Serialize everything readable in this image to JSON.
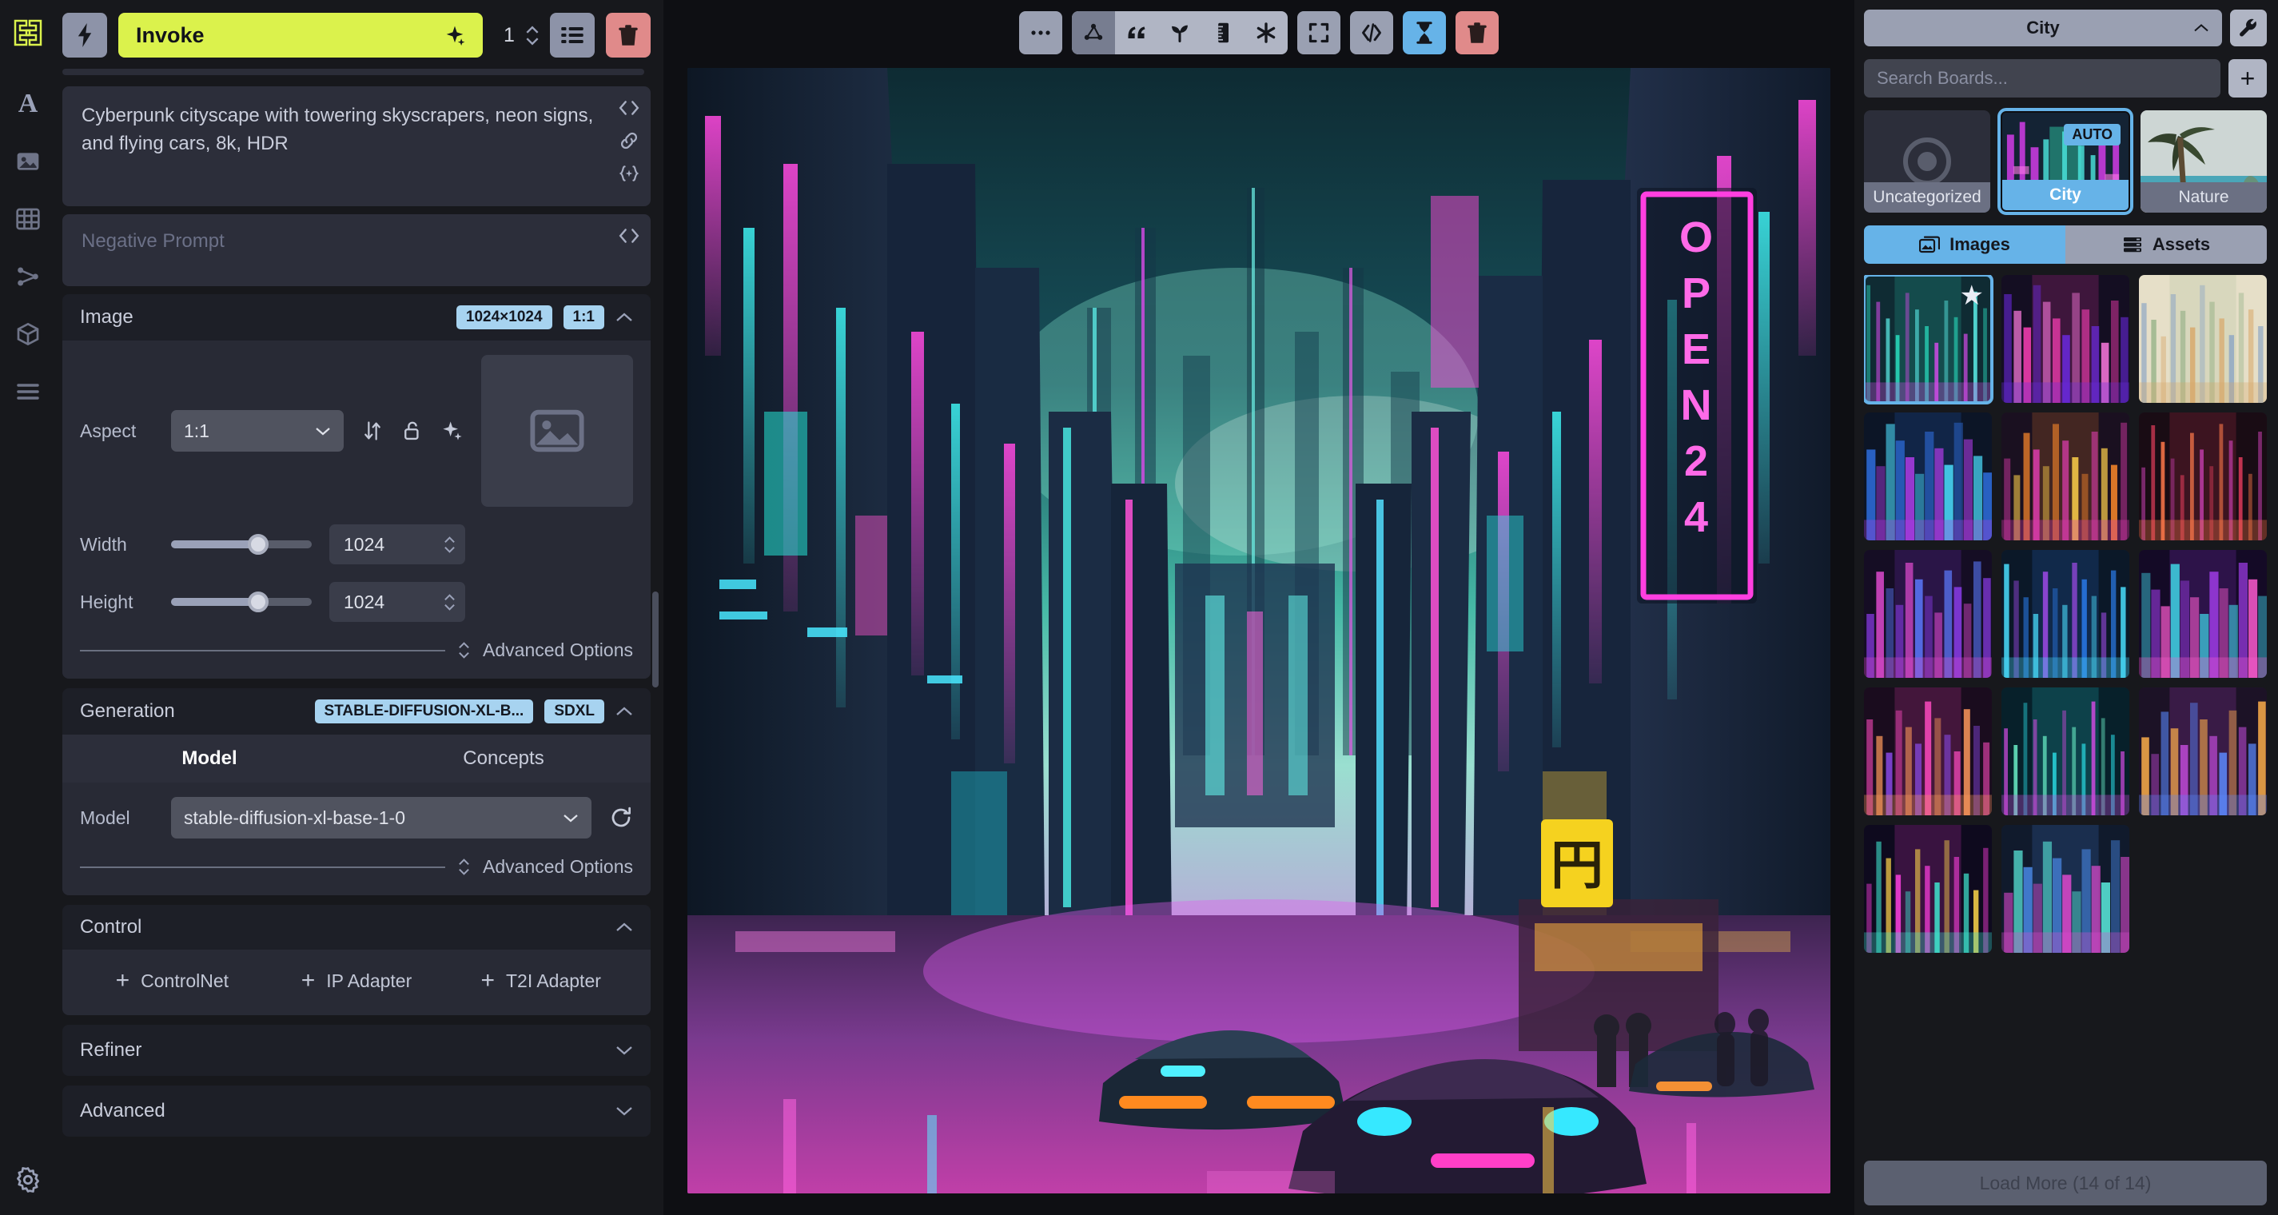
{
  "rail": {
    "logo_name": "invoke-logo",
    "items": [
      {
        "name": "text-to-image",
        "icon": "letter-A-icon",
        "label": "A"
      },
      {
        "name": "image-viewer",
        "icon": "image-icon",
        "label": ""
      },
      {
        "name": "grid-gallery",
        "icon": "grid-icon",
        "label": ""
      },
      {
        "name": "nodes-workflow",
        "icon": "nodes-icon",
        "label": ""
      },
      {
        "name": "models",
        "icon": "cube-icon",
        "label": ""
      },
      {
        "name": "queue-list",
        "icon": "list-icon",
        "label": ""
      }
    ],
    "settings_label": "gear-icon"
  },
  "topbar": {
    "bolt_icon": "lightning-bolt-icon",
    "invoke_label": "Invoke",
    "sparkle_icon": "sparkle-icon",
    "iterations": "1",
    "queue_icon": "queue-list-icon",
    "trash_icon": "trash-icon"
  },
  "prompt": {
    "positive": "Cyberpunk cityscape with towering skyscrapers, neon signs, and flying cars, 8k, HDR",
    "negative_placeholder": "Negative Prompt",
    "code_icon": "code-brackets-icon",
    "link_icon": "link-icon",
    "sparkle_icon": "sparkle-braces-icon"
  },
  "image_section": {
    "title": "Image",
    "size_badge": "1024×1024",
    "ratio_badge": "1:1",
    "aspect_label": "Aspect",
    "aspect_value": "1:1",
    "swap_icon": "swap-dimensions-icon",
    "lock_icon": "unlock-icon",
    "auto_icon": "sparkle-icon",
    "width_label": "Width",
    "width_value": "1024",
    "width_pct": 62,
    "height_label": "Height",
    "height_value": "1024",
    "height_pct": 62,
    "advanced_label": "Advanced Options",
    "thumb_icon": "image-placeholder-icon"
  },
  "generation_section": {
    "title": "Generation",
    "model_badge": "STABLE-DIFFUSION-XL-B...",
    "arch_badge": "SDXL",
    "tabs": [
      {
        "label": "Model",
        "active": true
      },
      {
        "label": "Concepts",
        "active": false
      }
    ],
    "model_label": "Model",
    "model_value": "stable-diffusion-xl-base-1-0",
    "refresh_icon": "refresh-icon",
    "advanced_label": "Advanced Options"
  },
  "control_section": {
    "title": "Control",
    "buttons": [
      {
        "label": "ControlNet",
        "name": "add-controlnet-button"
      },
      {
        "label": "IP Adapter",
        "name": "add-ip-adapter-button"
      },
      {
        "label": "T2I Adapter",
        "name": "add-t2i-adapter-button"
      }
    ]
  },
  "refiner_section": {
    "title": "Refiner"
  },
  "advanced_section": {
    "title": "Advanced"
  },
  "canvas": {
    "toolbar": [
      {
        "name": "more-options-button",
        "icon": "ellipsis-icon",
        "style": "plain"
      },
      {
        "name": "use-all-parameters-button",
        "icon": "nodes-share-icon",
        "style": "group-selected"
      },
      {
        "name": "use-prompt-button",
        "icon": "quotes-icon",
        "style": "group"
      },
      {
        "name": "use-seed-button",
        "icon": "seedling-icon",
        "style": "group"
      },
      {
        "name": "use-size-button",
        "icon": "ruler-icon",
        "style": "group"
      },
      {
        "name": "use-all-button",
        "icon": "asterisk-icon",
        "style": "group"
      },
      {
        "name": "fit-to-screen-button",
        "icon": "expand-brackets-icon",
        "style": "plain"
      },
      {
        "name": "show-metadata-button",
        "icon": "code-icon",
        "style": "plain"
      },
      {
        "name": "progress-toggle-button",
        "icon": "hourglass-icon",
        "style": "active"
      },
      {
        "name": "delete-image-button",
        "icon": "trash-icon",
        "style": "danger"
      }
    ]
  },
  "gallery": {
    "board_selected": "City",
    "board_chevron": "chevron-up-icon",
    "settings_icon": "wrench-icon",
    "search_placeholder": "Search Boards...",
    "add_board_label": "+",
    "boards": [
      {
        "label": "Uncategorized",
        "name": "board-uncategorized",
        "selected": false,
        "auto": false,
        "kind": "target"
      },
      {
        "label": "City",
        "name": "board-city",
        "selected": true,
        "auto": true,
        "auto_label": "AUTO",
        "kind": "city"
      },
      {
        "label": "Nature",
        "name": "board-nature",
        "selected": false,
        "auto": false,
        "kind": "nature"
      }
    ],
    "tabs": [
      {
        "label": "Images",
        "icon": "images-icon",
        "active": true
      },
      {
        "label": "Assets",
        "icon": "assets-icon",
        "active": false
      }
    ],
    "thumbnails": [
      {
        "kind": "city-teal",
        "selected": true,
        "starred": true
      },
      {
        "kind": "city-magenta",
        "selected": false,
        "starred": false
      },
      {
        "kind": "sketch",
        "selected": false,
        "starred": false
      },
      {
        "kind": "city-night",
        "selected": false,
        "starred": false
      },
      {
        "kind": "city-orange",
        "selected": false,
        "starred": false
      },
      {
        "kind": "city-red",
        "selected": false,
        "starred": false
      },
      {
        "kind": "city-purple",
        "selected": false,
        "starred": false
      },
      {
        "kind": "city-blue",
        "selected": false,
        "starred": false
      },
      {
        "kind": "city-violet",
        "selected": false,
        "starred": false
      },
      {
        "kind": "city-pink",
        "selected": false,
        "starred": false
      },
      {
        "kind": "city-cyan",
        "selected": false,
        "starred": false
      },
      {
        "kind": "city-dusk",
        "selected": false,
        "starred": false
      },
      {
        "kind": "city-neon",
        "selected": false,
        "starred": false
      },
      {
        "kind": "city-tower",
        "selected": false,
        "starred": false
      }
    ],
    "load_more_label": "Load More (14 of 14)"
  },
  "colors": {
    "accent_yellow": "#dbf24c",
    "accent_blue": "#66b3e8",
    "danger_red": "#e08a8a",
    "panel_bg": "#1d1f27",
    "app_bg": "#17181c"
  }
}
